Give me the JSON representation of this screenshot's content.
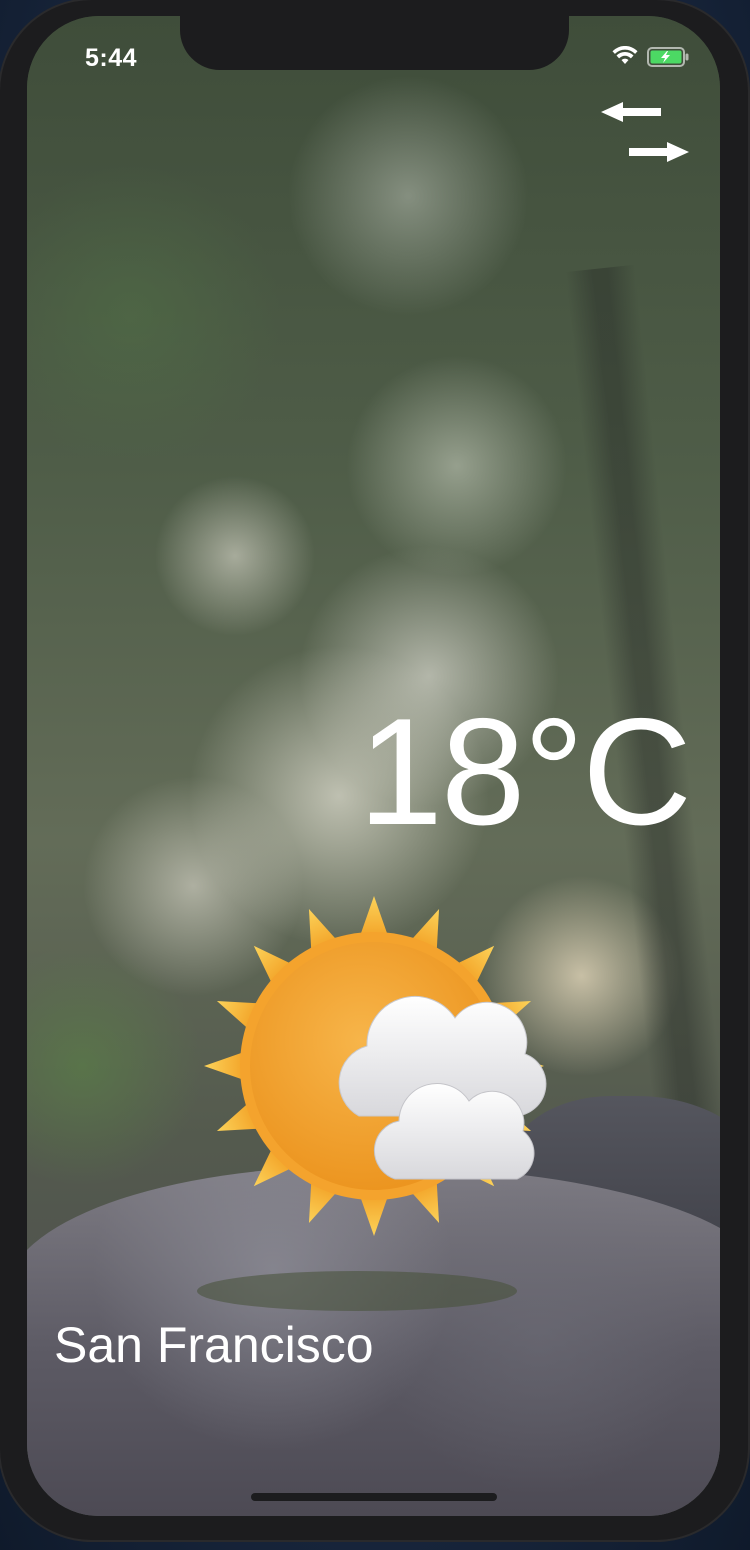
{
  "status_bar": {
    "time": "5:44",
    "wifi_icon": "wifi-icon",
    "battery_icon": "battery-charging-icon",
    "battery_color": "#4cd964"
  },
  "toolbar": {
    "swap_icon": "swap-arrows-icon"
  },
  "weather": {
    "temperature": "18°C",
    "condition_icon": "sun-behind-clouds-icon",
    "city": "San Francisco"
  },
  "colors": {
    "text": "#ffffff",
    "sun": "#f5a623",
    "cloud": "#f2f2f2"
  }
}
